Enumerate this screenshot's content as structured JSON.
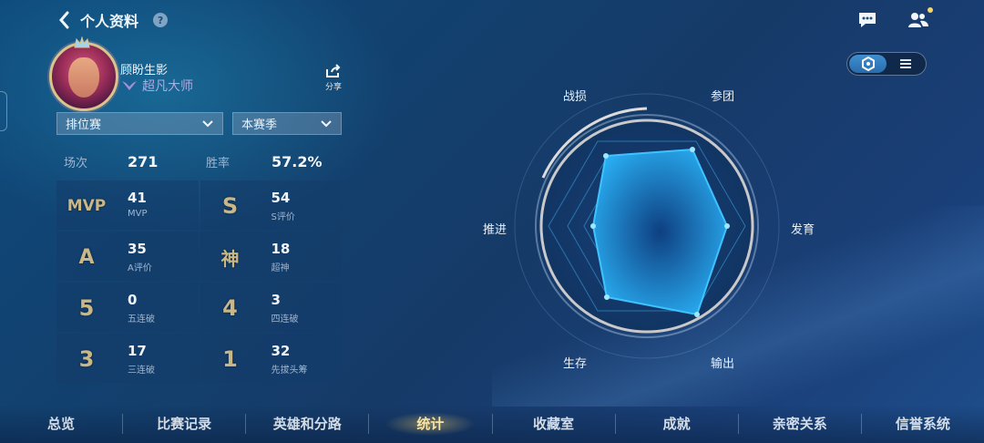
{
  "header": {
    "title": "个人资料",
    "help": "?"
  },
  "profile": {
    "name": "顾盼生影",
    "rank": "超凡大师",
    "share_label": "分享"
  },
  "filters": {
    "mode": "排位赛",
    "season": "本赛季"
  },
  "summary": {
    "games_label": "场次",
    "games": "271",
    "winrate_label": "胜率",
    "winrate": "57.2%"
  },
  "stats": [
    {
      "icon_text": "MVP",
      "value": "41",
      "label": "MVP"
    },
    {
      "icon_text": "S",
      "value": "54",
      "label": "S评价"
    },
    {
      "icon_text": "A",
      "value": "35",
      "label": "A评价"
    },
    {
      "icon_text": "神",
      "value": "18",
      "label": "超神"
    },
    {
      "icon_text": "5",
      "value": "0",
      "label": "五连破"
    },
    {
      "icon_text": "4",
      "value": "3",
      "label": "四连破"
    },
    {
      "icon_text": "3",
      "value": "17",
      "label": "三连破"
    },
    {
      "icon_text": "1",
      "value": "32",
      "label": "先拔头筹"
    }
  ],
  "radar": {
    "labels": {
      "top_left": "战损",
      "top_right": "参团",
      "right": "发育",
      "bottom_right": "输出",
      "bottom_left": "生存",
      "left": "推进"
    },
    "accent": "#2fb6ff"
  },
  "nav": [
    "总览",
    "比赛记录",
    "英雄和分路",
    "统计",
    "收藏室",
    "成就",
    "亲密关系",
    "信誉系统"
  ],
  "nav_active_index": 3,
  "colors": {
    "gold": "#c9b787",
    "active_nav": "#f8e3a2"
  }
}
